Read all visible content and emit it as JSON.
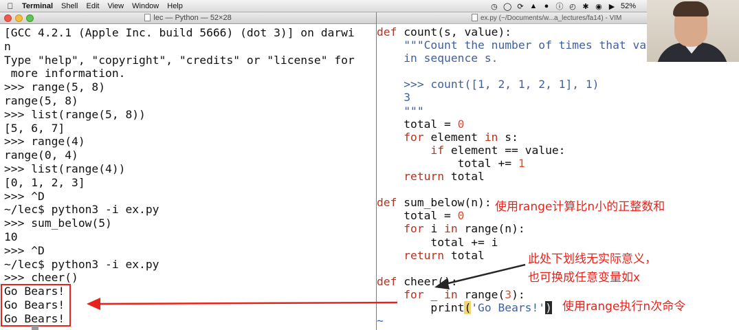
{
  "menubar": {
    "apple_icon": "apple-icon",
    "app_name": "Terminal",
    "items": [
      "Shell",
      "Edit",
      "View",
      "Window",
      "Help"
    ],
    "battery": "52%"
  },
  "terminal": {
    "title": "lec — Python — 52×28",
    "lines": [
      "[GCC 4.2.1 (Apple Inc. build 5666) (dot 3)] on darwi",
      "n",
      "Type \"help\", \"copyright\", \"credits\" or \"license\" for",
      " more information.",
      ">>> range(5, 8)",
      "range(5, 8)",
      ">>> list(range(5, 8))",
      "[5, 6, 7]",
      ">>> range(4)",
      "range(0, 4)",
      ">>> list(range(4))",
      "[0, 1, 2, 3]",
      ">>> ^D",
      "~/lec$ python3 -i ex.py",
      ">>> sum_below(5)",
      "10",
      ">>> ^D",
      "~/lec$ python3 -i ex.py",
      ">>> cheer()",
      "Go Bears!",
      "Go Bears!",
      "Go Bears!",
      ">>> "
    ]
  },
  "vim": {
    "title": "ex.py (~/Documents/w...a_lectures/fa14) - VIM",
    "lines": [
      [
        {
          "t": "def",
          "c": "kw"
        },
        {
          "t": " count(s, value):"
        }
      ],
      [
        {
          "t": "    "
        },
        {
          "t": "\"\"\"Count the number of times that val",
          "c": "str"
        }
      ],
      [
        {
          "t": "    "
        },
        {
          "t": "in sequence s.",
          "c": "str"
        }
      ],
      [
        {
          "t": ""
        }
      ],
      [
        {
          "t": "    "
        },
        {
          "t": ">>> count([1, 2, 1, 2, 1], 1)",
          "c": "str"
        }
      ],
      [
        {
          "t": "    "
        },
        {
          "t": "3",
          "c": "str"
        }
      ],
      [
        {
          "t": "    "
        },
        {
          "t": "\"\"\"",
          "c": "str"
        }
      ],
      [
        {
          "t": "    total = "
        },
        {
          "t": "0",
          "c": "num"
        }
      ],
      [
        {
          "t": "    "
        },
        {
          "t": "for",
          "c": "kw"
        },
        {
          "t": " element "
        },
        {
          "t": "in",
          "c": "kw"
        },
        {
          "t": " s:"
        }
      ],
      [
        {
          "t": "        "
        },
        {
          "t": "if",
          "c": "kw"
        },
        {
          "t": " element == value:"
        }
      ],
      [
        {
          "t": "            total += "
        },
        {
          "t": "1",
          "c": "num"
        }
      ],
      [
        {
          "t": "    "
        },
        {
          "t": "return",
          "c": "kw"
        },
        {
          "t": " total"
        }
      ],
      [
        {
          "t": ""
        }
      ],
      [
        {
          "t": "def",
          "c": "kw"
        },
        {
          "t": " sum_below(n):"
        }
      ],
      [
        {
          "t": "    total = "
        },
        {
          "t": "0",
          "c": "num"
        }
      ],
      [
        {
          "t": "    "
        },
        {
          "t": "for",
          "c": "kw"
        },
        {
          "t": " i "
        },
        {
          "t": "in",
          "c": "kw"
        },
        {
          "t": " range(n):"
        }
      ],
      [
        {
          "t": "        total += i"
        }
      ],
      [
        {
          "t": "    "
        },
        {
          "t": "return",
          "c": "kw"
        },
        {
          "t": " total"
        }
      ],
      [
        {
          "t": ""
        }
      ],
      [
        {
          "t": "def",
          "c": "kw"
        },
        {
          "t": " cheer():"
        }
      ],
      [
        {
          "t": "    "
        },
        {
          "t": "for",
          "c": "kw"
        },
        {
          "t": " _ "
        },
        {
          "t": "in",
          "c": "kw"
        },
        {
          "t": " range("
        },
        {
          "t": "3",
          "c": "num"
        },
        {
          "t": "):"
        }
      ],
      [
        {
          "t": "        print"
        },
        {
          "t": "(",
          "c": "paren-hl2"
        },
        {
          "t": "'Go Bears!'",
          "c": "str"
        },
        {
          "t": ")",
          "c": "paren-hl"
        }
      ],
      [
        {
          "t": "~",
          "c": "tilde"
        }
      ]
    ]
  },
  "annotations": {
    "note_range": "使用range计算比n小的正整数和",
    "note_underscore_1": "此处下划线无实际意义，",
    "note_underscore_2": "也可换成任意变量如x",
    "note_loop": "使用range执行n次命令",
    "color": "#e8231b"
  }
}
